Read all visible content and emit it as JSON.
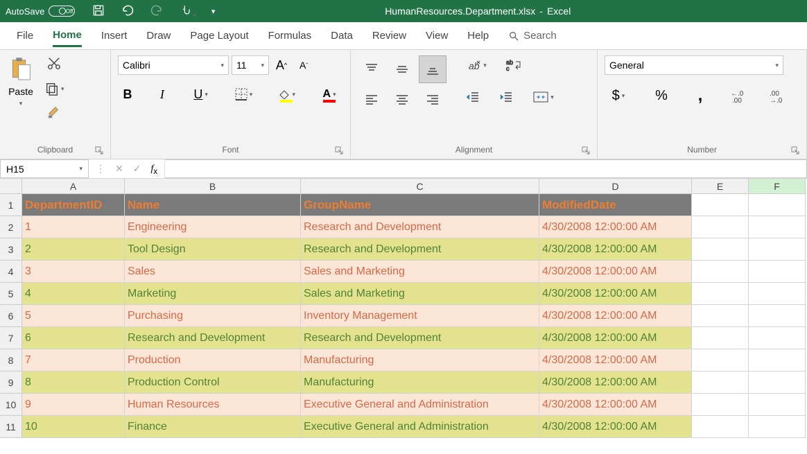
{
  "title": {
    "autosave": "AutoSave",
    "off": "Off",
    "filename": "HumanResources.Department.xlsx",
    "app": "Excel"
  },
  "tabs": {
    "file": "File",
    "home": "Home",
    "insert": "Insert",
    "draw": "Draw",
    "pagelayout": "Page Layout",
    "formulas": "Formulas",
    "data": "Data",
    "review": "Review",
    "view": "View",
    "help": "Help",
    "search": "Search"
  },
  "ribbon": {
    "clipboard": {
      "title": "Clipboard",
      "paste": "Paste"
    },
    "font": {
      "title": "Font",
      "name": "Calibri",
      "size": "11"
    },
    "alignment": {
      "title": "Alignment"
    },
    "number": {
      "title": "Number",
      "format": "General"
    }
  },
  "namebox": "H15",
  "columns": [
    "A",
    "B",
    "C",
    "D",
    "E",
    "F"
  ],
  "headers": {
    "A": "DepartmentID",
    "B": "Name",
    "C": "GroupName",
    "D": "ModifiedDate"
  },
  "rows": [
    {
      "id": "1",
      "name": "Engineering",
      "group": "Research and Development",
      "date": "4/30/2008 12:00:00 AM"
    },
    {
      "id": "2",
      "name": "Tool Design",
      "group": "Research and Development",
      "date": "4/30/2008 12:00:00 AM"
    },
    {
      "id": "3",
      "name": "Sales",
      "group": "Sales and Marketing",
      "date": "4/30/2008 12:00:00 AM"
    },
    {
      "id": "4",
      "name": "Marketing",
      "group": "Sales and Marketing",
      "date": "4/30/2008 12:00:00 AM"
    },
    {
      "id": "5",
      "name": "Purchasing",
      "group": "Inventory Management",
      "date": "4/30/2008 12:00:00 AM"
    },
    {
      "id": "6",
      "name": "Research and Development",
      "group": "Research and Development",
      "date": "4/30/2008 12:00:00 AM"
    },
    {
      "id": "7",
      "name": "Production",
      "group": "Manufacturing",
      "date": "4/30/2008 12:00:00 AM"
    },
    {
      "id": "8",
      "name": "Production Control",
      "group": "Manufacturing",
      "date": "4/30/2008 12:00:00 AM"
    },
    {
      "id": "9",
      "name": "Human Resources",
      "group": "Executive General and Administration",
      "date": "4/30/2008 12:00:00 AM"
    },
    {
      "id": "10",
      "name": "Finance",
      "group": "Executive General and Administration",
      "date": "4/30/2008 12:00:00 AM"
    }
  ]
}
